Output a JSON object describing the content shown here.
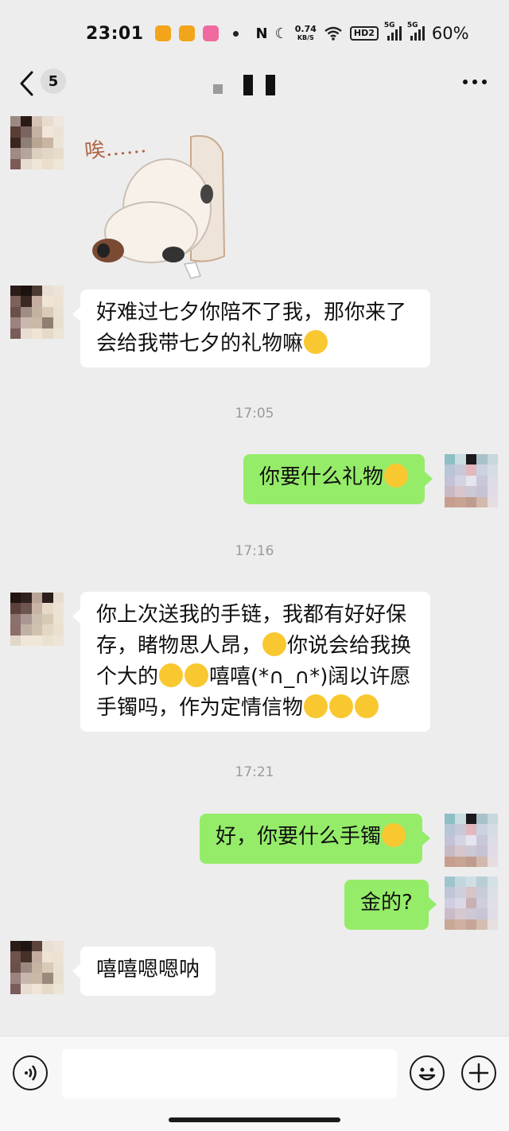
{
  "status_bar": {
    "time": "23:01",
    "net_speed_value": "0.74",
    "net_speed_unit": "KB/S",
    "hd_label": "HD2",
    "network_label_1": "5G",
    "network_label_2": "5G",
    "battery": "60%",
    "app_icon_colors": [
      "#f2a51a",
      "#f2a51a",
      "#f06aa0"
    ]
  },
  "header": {
    "unread_count": "5"
  },
  "messages": [
    {
      "type": "sticker",
      "side": "in",
      "caption": "唉……"
    },
    {
      "type": "text",
      "side": "in",
      "lines": [
        "好难过七夕你陪不了我，那你来了",
        "会给我带七夕的礼物嘛"
      ]
    },
    {
      "type": "time",
      "text": "17:05"
    },
    {
      "type": "text",
      "side": "out",
      "text": "你要什么礼物"
    },
    {
      "type": "time",
      "text": "17:16"
    },
    {
      "type": "text",
      "side": "in",
      "lines": [
        "你上次送我的手链，我都有好好保",
        "存，睹物思人昂，",
        "你说会给我换",
        "个大的",
        "嘻嘻(*∩_∩*)阔以许愿",
        "手镯吗，作为定情信物"
      ]
    },
    {
      "type": "time",
      "text": "17:21"
    },
    {
      "type": "text",
      "side": "out",
      "text": "好，你要什么手镯"
    },
    {
      "type": "text",
      "side": "out",
      "text": "金的?"
    },
    {
      "type": "text",
      "side": "in",
      "text": "嘻嘻嗯嗯呐"
    }
  ],
  "input": {
    "placeholder": ""
  },
  "colors": {
    "background": "#ededed",
    "bubble_in": "#ffffff",
    "bubble_out": "#95ec69"
  },
  "icons": [
    "back-chevron-icon",
    "more-dots-icon",
    "voice-icon",
    "emoji-face-icon",
    "plus-icon"
  ]
}
